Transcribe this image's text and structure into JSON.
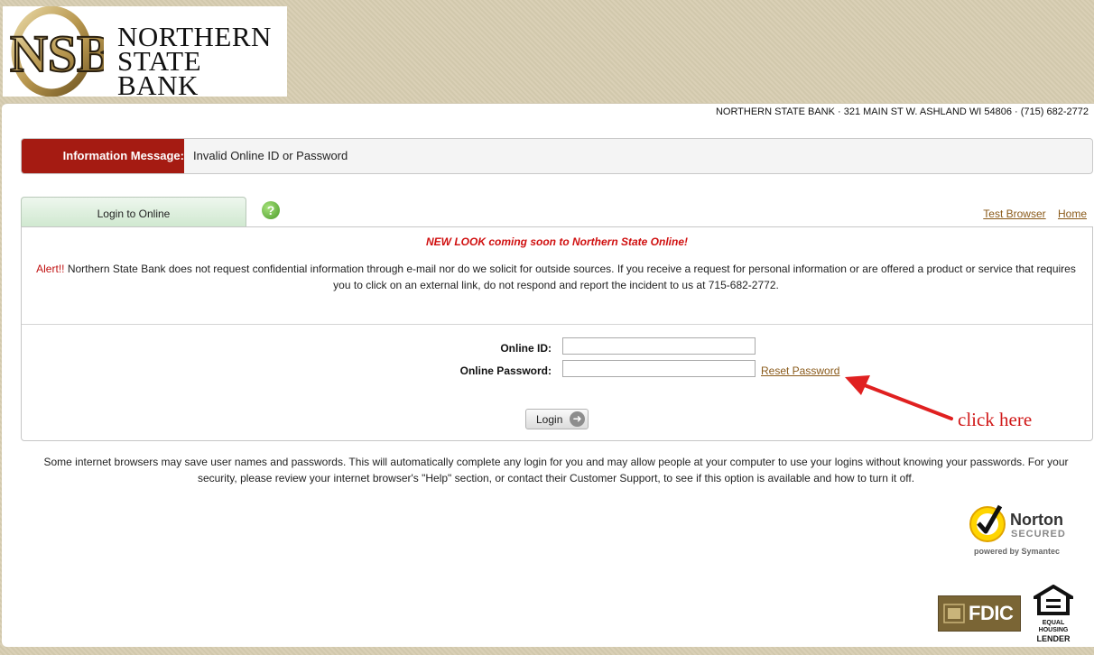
{
  "header": {
    "logo_monogram": "NSB",
    "logo_line1": "NORTHERN",
    "logo_line2": "STATE BANK",
    "address": "NORTHERN STATE BANK · 321 MAIN ST W. ASHLAND WI 54806 · (715) 682-2772"
  },
  "info_message": {
    "label": "Information Message:",
    "text": "Invalid Online ID or Password"
  },
  "tabs": {
    "login_tab": "Login to Online",
    "help_icon": "?"
  },
  "top_links": {
    "test_browser": "Test Browser",
    "home": "Home"
  },
  "notice": {
    "new_look": "NEW LOOK coming soon to Northern State Online!",
    "alert_word": "Alert!!",
    "alert_body": " Northern State Bank does not request confidential information through e-mail nor do we solicit for outside sources. If you receive a request for personal information or are offered a product or service that requires you to click on an external link, do not respond and report the incident to us at 715-682-2772."
  },
  "login_form": {
    "online_id_label": "Online ID:",
    "online_id_value": "",
    "password_label": "Online Password:",
    "password_value": "",
    "reset_password": "Reset Password",
    "login_button": "Login"
  },
  "security_note": "Some internet browsers may save user names and passwords. This will automatically complete any login for you and may allow people at your computer to use your logins without knowing your passwords. For your security, please review your internet browser's \"Help\" section, or contact their Customer Support, to see if this option is available and how to turn it off.",
  "annotation": {
    "click_here": "click here",
    "arrow_color": "#e02020"
  },
  "badges": {
    "norton_name": "Norton",
    "norton_secured": "SECURED",
    "norton_powered": "powered by Symantec",
    "fdic": "FDIC",
    "ehl_line1": "EQUAL HOUSING",
    "ehl_line2": "LENDER"
  },
  "colors": {
    "info_label_bg": "#a51b12",
    "alert_red": "#d01010",
    "link_brown": "#8a5a1a",
    "tab_green": "#cfe8cf"
  }
}
